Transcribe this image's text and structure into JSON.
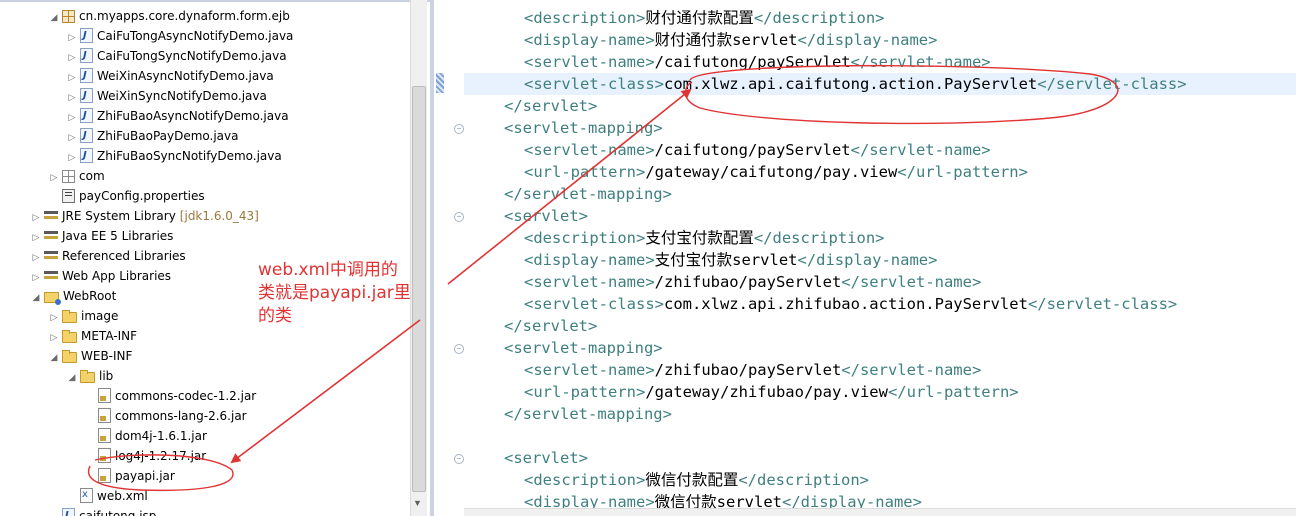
{
  "explorer": {
    "items": [
      {
        "label": "cn.myapps.core.dynaform.form.ejb",
        "icon": "package-icon",
        "arrow": "open"
      },
      {
        "label": "CaiFuTongAsyncNotifyDemo.java",
        "icon": "java-file-icon",
        "arrow": "closed"
      },
      {
        "label": "CaiFuTongSyncNotifyDemo.java",
        "icon": "java-file-icon",
        "arrow": "closed"
      },
      {
        "label": "WeiXinAsyncNotifyDemo.java",
        "icon": "java-file-icon",
        "arrow": "closed"
      },
      {
        "label": "WeiXinSyncNotifyDemo.java",
        "icon": "java-file-icon",
        "arrow": "closed"
      },
      {
        "label": "ZhiFuBaoAsyncNotifyDemo.java",
        "icon": "java-file-icon",
        "arrow": "closed"
      },
      {
        "label": "ZhiFuBaoPayDemo.java",
        "icon": "java-file-icon",
        "arrow": "closed"
      },
      {
        "label": "ZhiFuBaoSyncNotifyDemo.java",
        "icon": "java-file-icon",
        "arrow": "closed"
      },
      {
        "label": "com",
        "icon": "package-icon",
        "arrow": "closed"
      },
      {
        "label": "payConfig.properties",
        "icon": "properties-file-icon",
        "arrow": ""
      },
      {
        "label": "JRE System Library",
        "sub": "[jdk1.6.0_43]",
        "icon": "library-icon",
        "arrow": "closed"
      },
      {
        "label": "Java EE 5 Libraries",
        "icon": "library-icon",
        "arrow": "closed"
      },
      {
        "label": "Referenced Libraries",
        "icon": "library-icon",
        "arrow": "closed"
      },
      {
        "label": "Web App Libraries",
        "icon": "library-icon",
        "arrow": "closed"
      },
      {
        "label": "WebRoot",
        "icon": "webroot-folder-icon",
        "arrow": "open"
      },
      {
        "label": "image",
        "icon": "folder-icon",
        "arrow": "closed"
      },
      {
        "label": "META-INF",
        "icon": "folder-icon",
        "arrow": "closed"
      },
      {
        "label": "WEB-INF",
        "icon": "folder-icon",
        "arrow": "open"
      },
      {
        "label": "lib",
        "icon": "folder-icon",
        "arrow": "open"
      },
      {
        "label": "commons-codec-1.2.jar",
        "icon": "jar-file-icon",
        "arrow": ""
      },
      {
        "label": "commons-lang-2.6.jar",
        "icon": "jar-file-icon",
        "arrow": ""
      },
      {
        "label": "dom4j-1.6.1.jar",
        "icon": "jar-file-icon",
        "arrow": ""
      },
      {
        "label": "log4j-1.2.17.jar",
        "icon": "jar-file-icon",
        "arrow": ""
      },
      {
        "label": "payapi.jar",
        "icon": "jar-file-icon",
        "arrow": ""
      },
      {
        "label": "web.xml",
        "icon": "xml-file-icon",
        "arrow": ""
      },
      {
        "label": "caifutong.jsp",
        "icon": "jsp-file-icon",
        "arrow": ""
      }
    ]
  },
  "annotation": {
    "lines": [
      "web.xml中调用的",
      "类就是payapi.jar里",
      "的类"
    ],
    "color": "#e03333"
  },
  "editor": {
    "lines": [
      {
        "parts": [
          [
            "t",
            "<description>"
          ],
          [
            "x",
            "财付通付款配置"
          ],
          [
            "t",
            "</description>"
          ]
        ]
      },
      {
        "parts": [
          [
            "t",
            "<display-name>"
          ],
          [
            "x",
            "财付通付款servlet"
          ],
          [
            "t",
            "</display-name>"
          ]
        ]
      },
      {
        "parts": [
          [
            "t",
            "<servlet-name>"
          ],
          [
            "x",
            "/caifutong/payServlet"
          ],
          [
            "t",
            "</servlet-name>"
          ]
        ]
      },
      {
        "parts": [
          [
            "t",
            "<servlet-class>"
          ],
          [
            "x",
            "com.xlwz.api.caifutong.action.PayServlet"
          ],
          [
            "t",
            "</servlet-class>"
          ]
        ],
        "highlight": true
      },
      {
        "parts": [
          [
            "t",
            "</servlet>"
          ]
        ]
      },
      {
        "parts": [
          [
            "t",
            "<servlet-mapping>"
          ]
        ],
        "fold": true
      },
      {
        "parts": [
          [
            "t",
            "<servlet-name>"
          ],
          [
            "x",
            "/caifutong/payServlet"
          ],
          [
            "t",
            "</servlet-name>"
          ]
        ]
      },
      {
        "parts": [
          [
            "t",
            "<url-pattern>"
          ],
          [
            "x",
            "/gateway/caifutong/pay.view"
          ],
          [
            "t",
            "</url-pattern>"
          ]
        ]
      },
      {
        "parts": [
          [
            "t",
            "</servlet-mapping>"
          ]
        ]
      },
      {
        "parts": [
          [
            "t",
            "<servlet>"
          ]
        ],
        "fold": true
      },
      {
        "parts": [
          [
            "t",
            "<description>"
          ],
          [
            "x",
            "支付宝付款配置"
          ],
          [
            "t",
            "</description>"
          ]
        ]
      },
      {
        "parts": [
          [
            "t",
            "<display-name>"
          ],
          [
            "x",
            "支付宝付款servlet"
          ],
          [
            "t",
            "</display-name>"
          ]
        ]
      },
      {
        "parts": [
          [
            "t",
            "<servlet-name>"
          ],
          [
            "x",
            "/zhifubao/payServlet"
          ],
          [
            "t",
            "</servlet-name>"
          ]
        ]
      },
      {
        "parts": [
          [
            "t",
            "<servlet-class>"
          ],
          [
            "x",
            "com.xlwz.api.zhifubao.action.PayServlet"
          ],
          [
            "t",
            "</servlet-class>"
          ]
        ]
      },
      {
        "parts": [
          [
            "t",
            "</servlet>"
          ]
        ]
      },
      {
        "parts": [
          [
            "t",
            "<servlet-mapping>"
          ]
        ],
        "fold": true
      },
      {
        "parts": [
          [
            "t",
            "<servlet-name>"
          ],
          [
            "x",
            "/zhifubao/payServlet"
          ],
          [
            "t",
            "</servlet-name>"
          ]
        ]
      },
      {
        "parts": [
          [
            "t",
            "<url-pattern>"
          ],
          [
            "x",
            "/gateway/zhifubao/pay.view"
          ],
          [
            "t",
            "</url-pattern>"
          ]
        ]
      },
      {
        "parts": [
          [
            "t",
            "</servlet-mapping>"
          ]
        ]
      },
      {
        "parts": []
      },
      {
        "parts": [
          [
            "t",
            "<servlet>"
          ]
        ],
        "fold": true
      },
      {
        "parts": [
          [
            "t",
            "<description>"
          ],
          [
            "x",
            "微信付款配置"
          ],
          [
            "t",
            "</description>"
          ]
        ]
      },
      {
        "parts": [
          [
            "t",
            "<display-name>"
          ],
          [
            "x",
            "微信付款servlet"
          ],
          [
            "t",
            "</display-name>"
          ]
        ]
      }
    ]
  },
  "colors": {
    "tag": "#3f7f7f",
    "text": "#000000",
    "highlight_line": "#e8f2fe",
    "annotation_red": "#e03333"
  }
}
